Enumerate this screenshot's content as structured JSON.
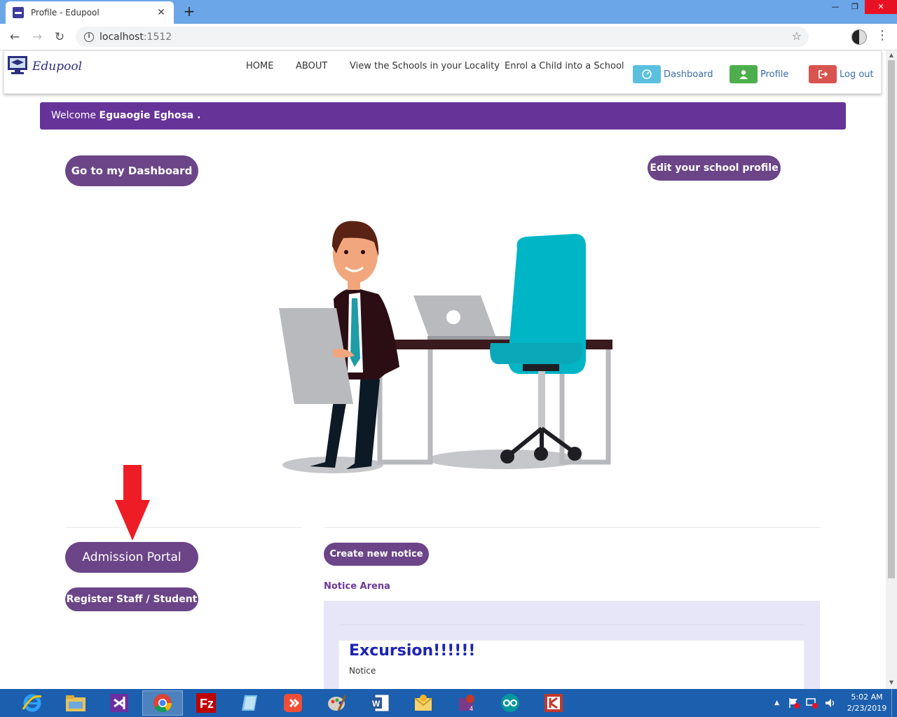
{
  "browser": {
    "tab_title": "Profile - Edupool",
    "url_host": "localhost",
    "url_port": ":1512"
  },
  "site": {
    "logo_text": "Edupool",
    "menu": [
      "HOME",
      "ABOUT",
      "View the Schools in your Locality",
      "Enrol a Child into a School"
    ],
    "dashboard_label": "Dashboard",
    "profile_label": "Profile",
    "logout_label": "Log out",
    "colors": {
      "dashboard": "#5bc0de",
      "profile": "#4cae4c",
      "logout": "#d9534f",
      "purple": "#663399"
    }
  },
  "welcome": {
    "prefix": "Welcome",
    "name": "Eguaogie Eghosa ."
  },
  "actions": {
    "go_dashboard": "Go to my Dashboard",
    "edit_profile": "Edit your school profile",
    "admission_portal": "Admission Portal",
    "register": "Register Staff / Student",
    "create_notice": "Create new notice"
  },
  "notices": {
    "arena_label": "Notice Arena",
    "items": [
      {
        "title": "Excursion!!!!!!",
        "subtitle": "Notice"
      }
    ]
  },
  "taskbar": {
    "time": "5:02 AM",
    "date": "2/23/2019",
    "apps": [
      "ie-icon",
      "file-explorer-icon",
      "visual-studio-icon",
      "chrome-icon",
      "filezilla-icon",
      "notepad-icon",
      "git-icon",
      "paint-icon",
      "word-icon",
      "outlook-icon",
      "media-icon",
      "arduino-icon",
      "antivirus-icon"
    ]
  }
}
